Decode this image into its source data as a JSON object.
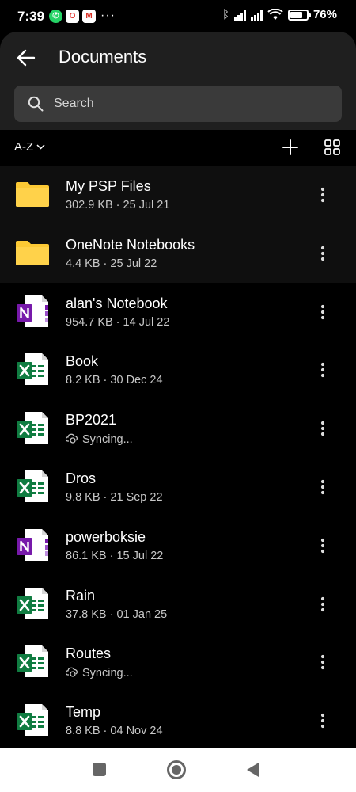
{
  "status_bar": {
    "time": "7:39",
    "notifications": [
      "whatsapp-icon",
      "opera-icon",
      "gmail-icon"
    ],
    "more": "···",
    "battery_percent": "76%",
    "battery_level": 0.76
  },
  "header": {
    "title": "Documents",
    "back_icon": "arrow-left-icon",
    "search_placeholder": "Search"
  },
  "toolbar": {
    "sort_label": "A-Z",
    "add_icon": "plus-icon",
    "view_icon": "grid-view-icon"
  },
  "files": [
    {
      "name": "My PSP Files",
      "meta": "302.9 KB · 25 Jul 21",
      "type": "folder",
      "syncing": false
    },
    {
      "name": "OneNote Notebooks",
      "meta": "4.4 KB · 25 Jul 22",
      "type": "folder",
      "syncing": false
    },
    {
      "name": "alan's Notebook",
      "meta": "954.7 KB · 14 Jul 22",
      "type": "onenote",
      "syncing": false
    },
    {
      "name": "Book",
      "meta": "8.2 KB · 30 Dec 24",
      "type": "excel",
      "syncing": false
    },
    {
      "name": "BP2021",
      "meta": "Syncing...",
      "type": "excel",
      "syncing": true
    },
    {
      "name": "Dros",
      "meta": "9.8 KB · 21 Sep 22",
      "type": "excel",
      "syncing": false
    },
    {
      "name": "powerboksie",
      "meta": "86.1 KB · 15 Jul 22",
      "type": "onenote",
      "syncing": false
    },
    {
      "name": "Rain",
      "meta": "37.8 KB · 01 Jan 25",
      "type": "excel",
      "syncing": false
    },
    {
      "name": "Routes",
      "meta": "Syncing...",
      "type": "excel",
      "syncing": true
    },
    {
      "name": "Temp",
      "meta": "8.8 KB · 04 Nov 24",
      "type": "excel",
      "syncing": false
    }
  ],
  "colors": {
    "folder": "#fcc934",
    "excel": "#107c41",
    "onenote": "#7719aa",
    "header_bg": "#1f1f1f",
    "search_bg": "#3a3a3a"
  }
}
